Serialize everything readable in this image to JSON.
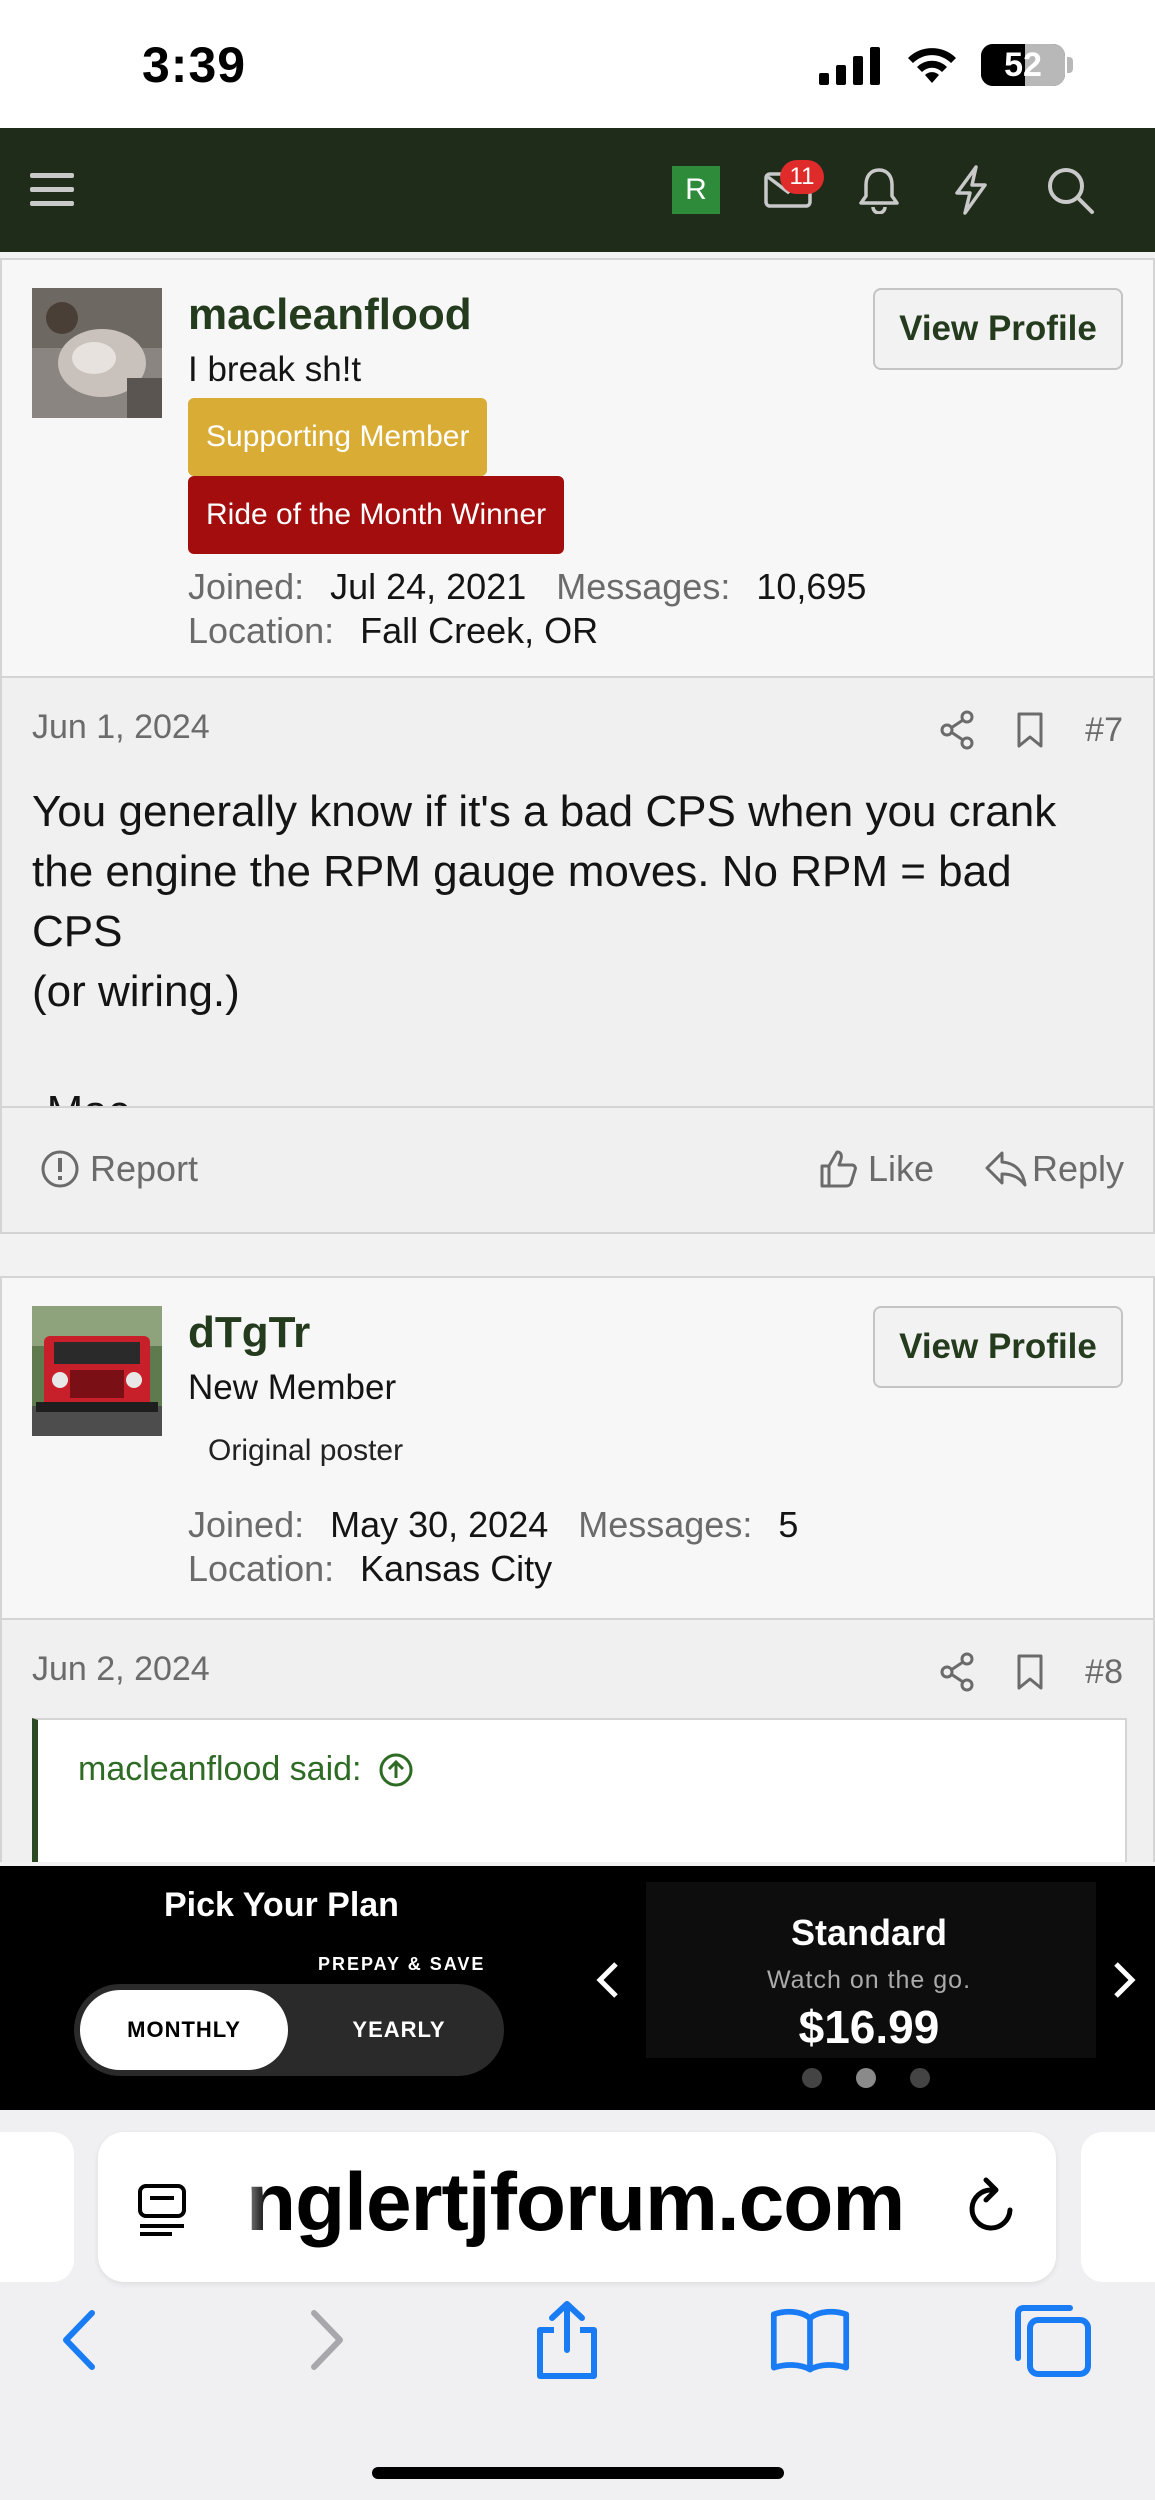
{
  "status_bar": {
    "time": "3:39",
    "battery": "52"
  },
  "header": {
    "user_initial": "R",
    "mail_count": "11"
  },
  "posts": [
    {
      "username": "macleanflood",
      "user_title": "I break sh!t",
      "view_profile": "View Profile",
      "badges": [
        "Supporting Member",
        "Ride of the Month Winner"
      ],
      "joined_label": "Joined:",
      "joined": "Jul 24, 2021",
      "messages_label": "Messages:",
      "messages": "10,695",
      "location_label": "Location:",
      "location": "Fall Creek, OR",
      "date": "Jun 1, 2024",
      "number": "#7",
      "body_line1": "You generally know if it's a bad CPS when you crank",
      "body_line2": "the engine the RPM gauge moves. No RPM = bad CPS",
      "body_line3": "(or wiring.)",
      "signature": "-Mac",
      "actions": {
        "report": "Report",
        "like": "Like",
        "reply": "Reply"
      }
    },
    {
      "username": "dTgTr",
      "user_title": "New Member",
      "view_profile": "View Profile",
      "badge_plain": "Original poster",
      "joined_label": "Joined:",
      "joined": "May 30, 2024",
      "messages_label": "Messages:",
      "messages": "5",
      "location_label": "Location:",
      "location": "Kansas City",
      "date": "Jun 2, 2024",
      "number": "#8",
      "quote_author": "macleanflood said:"
    }
  ],
  "ad": {
    "title": "Pick Your Plan",
    "prepay": "PREPAY & SAVE",
    "toggle_monthly": "MONTHLY",
    "toggle_yearly": "YEARLY",
    "plan_name": "Standard",
    "plan_sub": "Watch on the go.",
    "plan_price": "$16.99",
    "active_slide": 2,
    "slide_count": 3
  },
  "safari": {
    "url": "nglertjforum.com"
  },
  "colors": {
    "header_bg": "#1f2c1a",
    "username": "#243b1e",
    "badge_gold": "#d8ac35",
    "badge_red": "#a30d0d",
    "mail_badge": "#e02b2b"
  }
}
